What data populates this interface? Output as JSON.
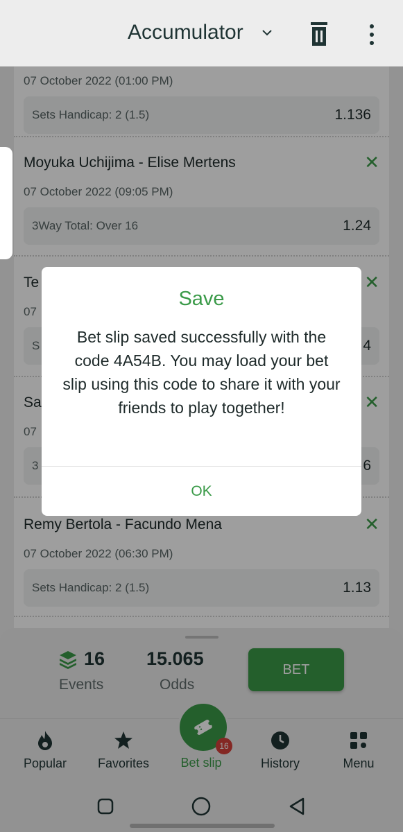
{
  "header": {
    "title": "Accumulator"
  },
  "events": [
    {
      "teams": "",
      "date": "07 October 2022 (01:00 PM)",
      "market": "Sets Handicap: 2 (1.5)",
      "odd": "1.136"
    },
    {
      "teams": "Moyuka Uchijima - Elise Mertens",
      "date": "07 October 2022 (09:05 PM)",
      "market": "3Way Total: Over 16",
      "odd": "1.24"
    },
    {
      "teams": "Te",
      "date": "07",
      "market": "S",
      "odd": "4"
    },
    {
      "teams": "Sa",
      "date": "07",
      "market": "3",
      "odd": "6"
    },
    {
      "teams": "Remy Bertola - Facundo Mena",
      "date": "07 October 2022 (06:30 PM)",
      "market": "Sets Handicap: 2 (1.5)",
      "odd": "1.13"
    }
  ],
  "summary": {
    "events_count": "16",
    "events_label": "Events",
    "odds_value": "15.065",
    "odds_label": "Odds",
    "bet_label": "BET"
  },
  "nav": [
    {
      "label": "Popular",
      "icon": "flame-icon"
    },
    {
      "label": "Favorites",
      "icon": "star-icon"
    },
    {
      "label": "Bet slip",
      "icon": "ticket-icon",
      "badge": "16"
    },
    {
      "label": "History",
      "icon": "clock-icon"
    },
    {
      "label": "Menu",
      "icon": "grid-icon"
    }
  ],
  "dialog": {
    "title": "Save",
    "message": "Bet slip saved successfully with the code 4A54B. You may load your bet slip using this code to share it with your friends to play together!",
    "ok_label": "OK"
  },
  "colors": {
    "accent": "#3a9a48",
    "badge": "#d6413a"
  }
}
